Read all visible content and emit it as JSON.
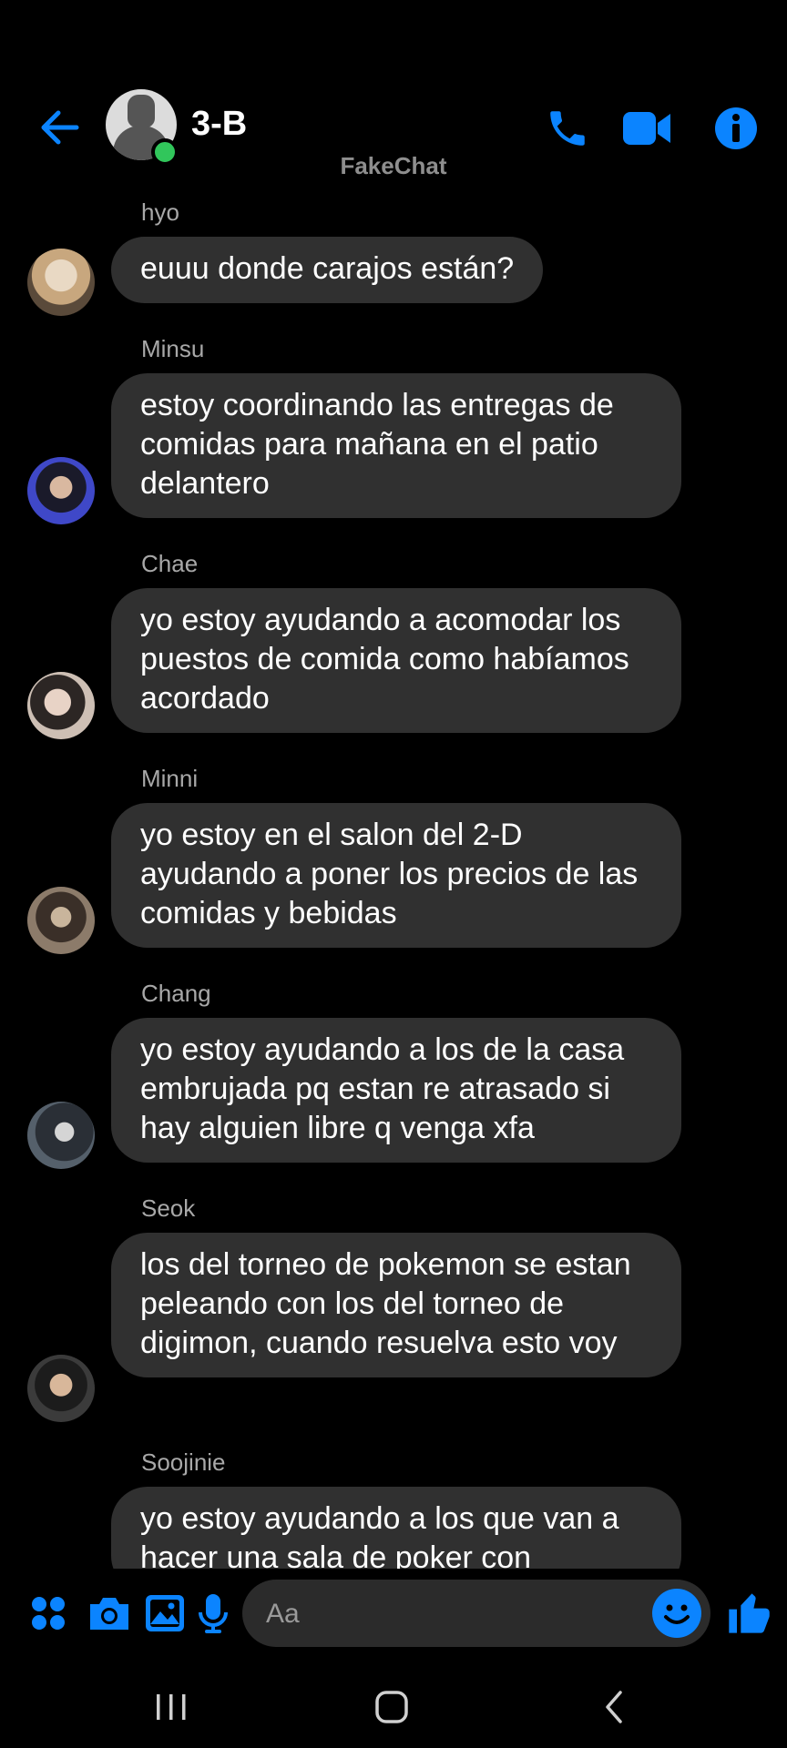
{
  "header": {
    "title": "3-B",
    "watermark": "FakeChat",
    "accent_color": "#0b84ff",
    "online_color": "#31c65b",
    "icons": [
      "back-arrow-icon",
      "phone-icon",
      "video-camera-icon",
      "info-icon"
    ]
  },
  "messages": [
    {
      "sender": "hyo",
      "text": "euuu donde carajos están?"
    },
    {
      "sender": "Minsu",
      "text": "estoy coordinando las entregas de comidas para mañana en el patio delantero"
    },
    {
      "sender": "Chae",
      "text": "yo estoy ayudando a acomodar los puestos de comida como habíamos acordado"
    },
    {
      "sender": "Minni",
      "text": "yo estoy en el salon del 2-D ayudando a poner los precios de las comidas y bebidas"
    },
    {
      "sender": "Chang",
      "text": "yo estoy ayudando a los de la casa embrujada pq estan re atrasado si hay alguien libre q venga xfa"
    },
    {
      "sender": "Seok",
      "text": "los del torneo de pokemon se estan peleando con los del torneo de digimon, cuando resuelva esto voy"
    },
    {
      "sender": "Soojinie",
      "text": "yo estoy ayudando a los que van a hacer una sala de poker con"
    }
  ],
  "composer": {
    "placeholder": "Aa",
    "icons": [
      "apps-grid-icon",
      "camera-icon",
      "gallery-icon",
      "microphone-icon",
      "emoji-icon",
      "thumbs-up-icon"
    ]
  },
  "navbar": {
    "icons": [
      "recent-apps-icon",
      "home-icon",
      "back-icon"
    ]
  }
}
